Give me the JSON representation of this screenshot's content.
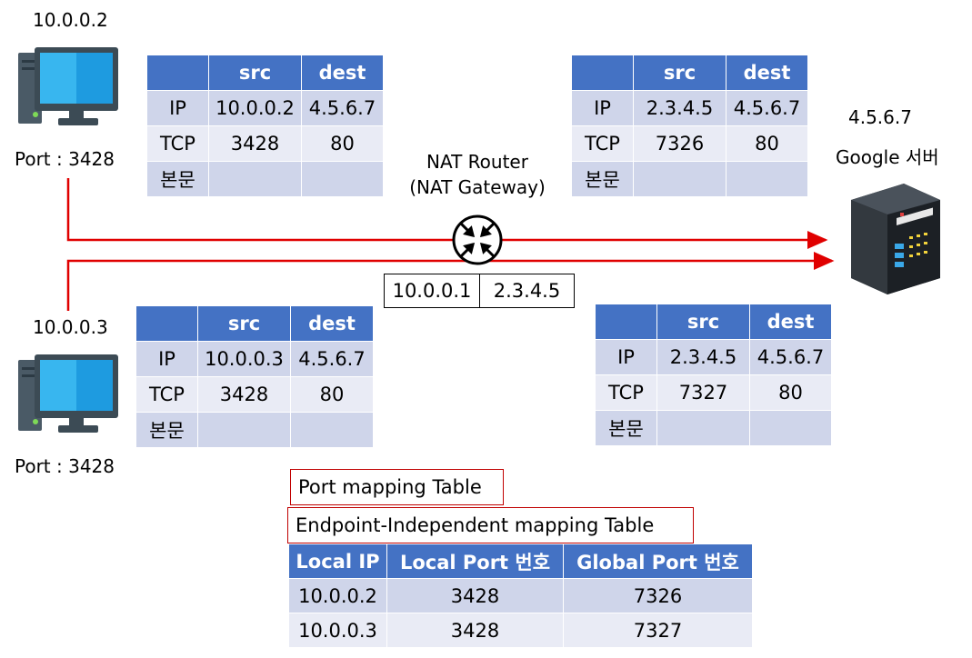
{
  "host1": {
    "ip": "10.0.0.2",
    "port_label": "Port : 3428"
  },
  "host2": {
    "ip": "10.0.0.3",
    "port_label": "Port : 3428"
  },
  "server": {
    "ip": "4.5.6.7",
    "name": "Google 서버"
  },
  "router": {
    "line1": "NAT Router",
    "line2": "(NAT Gateway)",
    "inside_ip": "10.0.0.1",
    "outside_ip": "2.3.4.5"
  },
  "packet_headers": {
    "blank": "",
    "src": "src",
    "dest": "dest"
  },
  "packets": {
    "p1": {
      "rows": [
        [
          "IP",
          "10.0.0.2",
          "4.5.6.7"
        ],
        [
          "TCP",
          "3428",
          "80"
        ],
        [
          "본문",
          "",
          ""
        ]
      ]
    },
    "p2": {
      "rows": [
        [
          "IP",
          "2.3.4.5",
          "4.5.6.7"
        ],
        [
          "TCP",
          "7326",
          "80"
        ],
        [
          "본문",
          "",
          ""
        ]
      ]
    },
    "p3": {
      "rows": [
        [
          "IP",
          "10.0.0.3",
          "4.5.6.7"
        ],
        [
          "TCP",
          "3428",
          "80"
        ],
        [
          "본문",
          "",
          ""
        ]
      ]
    },
    "p4": {
      "rows": [
        [
          "IP",
          "2.3.4.5",
          "4.5.6.7"
        ],
        [
          "TCP",
          "7327",
          "80"
        ],
        [
          "본문",
          "",
          ""
        ]
      ]
    }
  },
  "mapping": {
    "title1": "Port mapping Table",
    "title2": "Endpoint-Independent mapping Table",
    "headers": [
      "Local IP",
      "Local Port 번호",
      "Global Port 번호"
    ],
    "rows": [
      [
        "10.0.0.2",
        "3428",
        "7326"
      ],
      [
        "10.0.0.3",
        "3428",
        "7327"
      ]
    ]
  },
  "colors": {
    "arrow": "#e00000",
    "header": "#4472c4",
    "row_dark": "#cfd5ea",
    "row_light": "#e9ebf5",
    "monitor": "#1e9be0"
  },
  "icons": [
    "computer-icon",
    "computer-icon",
    "server-icon",
    "router-icon"
  ]
}
